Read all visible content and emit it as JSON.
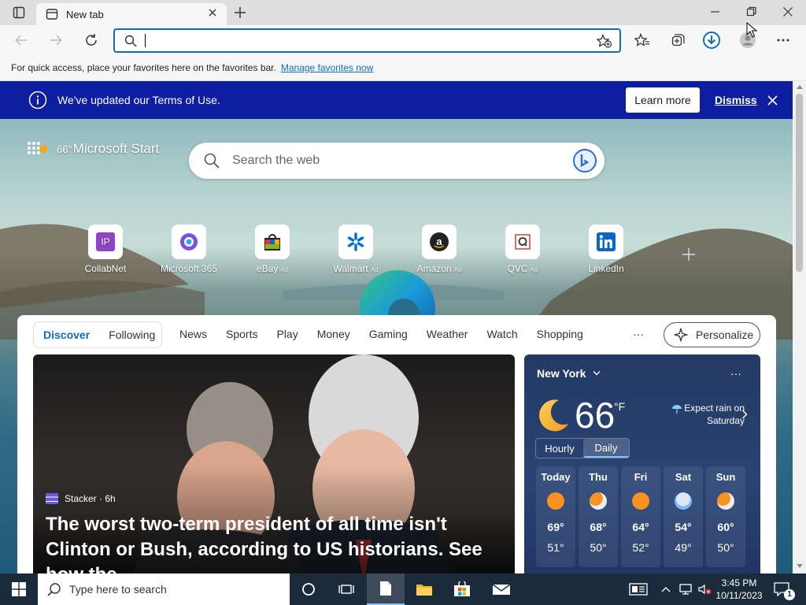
{
  "browser": {
    "tab_title": "New tab",
    "address_value": "",
    "favorites_hint": "For quick access, place your favorites here on the favorites bar.",
    "favorites_link": "Manage favorites now"
  },
  "notice": {
    "text": "We've updated our Terms of Use.",
    "learn_more": "Learn more",
    "dismiss": "Dismiss"
  },
  "page": {
    "brand": "Microsoft Start",
    "temp_badge": "66°",
    "search_placeholder": "Search the web",
    "quick_links": [
      {
        "label": "CollabNet",
        "ad": ""
      },
      {
        "label": "Microsoft 365",
        "ad": ""
      },
      {
        "label": "eBay",
        "ad": "Ad"
      },
      {
        "label": "Walmart",
        "ad": "Ad"
      },
      {
        "label": "Amazon",
        "ad": "Ad"
      },
      {
        "label": "QVC",
        "ad": "Ad"
      },
      {
        "label": "LinkedIn",
        "ad": ""
      }
    ]
  },
  "feed": {
    "tabs": [
      "Discover",
      "Following"
    ],
    "nav": [
      "News",
      "Sports",
      "Play",
      "Money",
      "Gaming",
      "Weather",
      "Watch",
      "Shopping"
    ],
    "more": "···",
    "personalize": "Personalize"
  },
  "news": {
    "source": "Stacker · 6h",
    "headline": "The worst two-term president of all time isn't Clinton or Bush, according to US historians. See how the..."
  },
  "weather": {
    "city": "New York",
    "temp": "66",
    "unit": "°F",
    "alert": "Expect rain on Saturday",
    "tab_hourly": "Hourly",
    "tab_daily": "Daily",
    "days": [
      {
        "name": "Today",
        "hi": "69°",
        "lo": "51°",
        "icon": "sun-icon"
      },
      {
        "name": "Thu",
        "hi": "68°",
        "lo": "50°",
        "icon": "partly-cloudy-icon"
      },
      {
        "name": "Fri",
        "hi": "64°",
        "lo": "52°",
        "icon": "sun-icon"
      },
      {
        "name": "Sat",
        "hi": "54°",
        "lo": "49°",
        "icon": "rain-icon"
      },
      {
        "name": "Sun",
        "hi": "60°",
        "lo": "50°",
        "icon": "partly-cloudy-icon"
      }
    ]
  },
  "taskbar": {
    "search_placeholder": "Type here to search",
    "time": "3:45 PM",
    "date": "10/11/2023",
    "notif_count": "1"
  },
  "colors": {
    "accent": "#0f6cbd",
    "notice_bg": "#0d1fa0",
    "taskbar": "#1c2b3c"
  }
}
